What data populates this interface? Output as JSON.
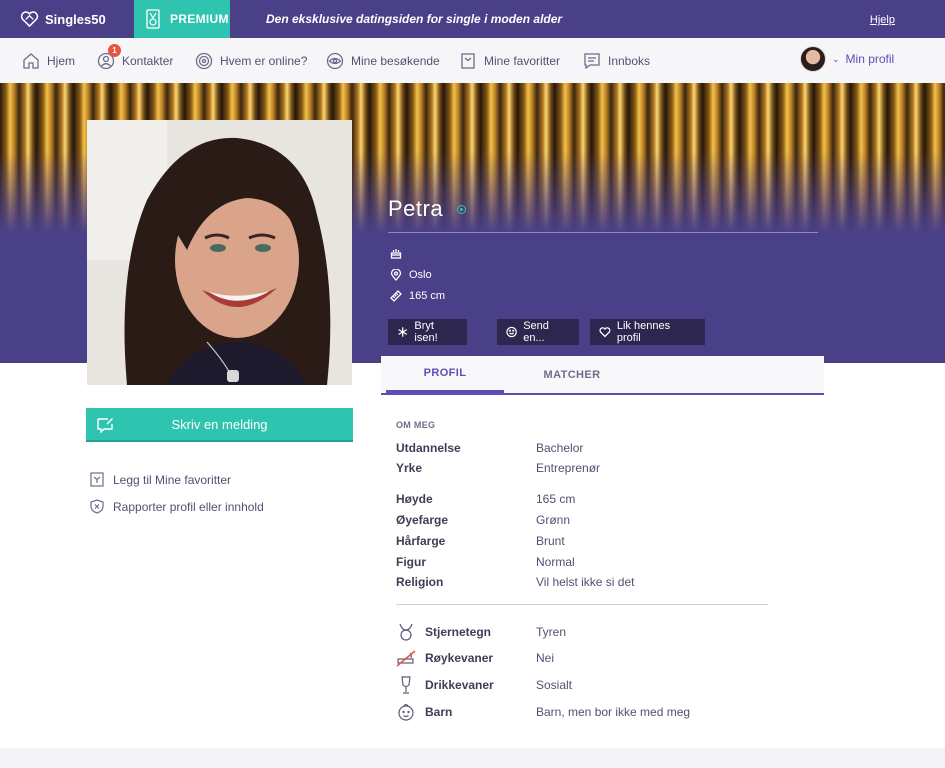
{
  "topbar": {
    "brand": "Singles50",
    "premium": "PREMIUM",
    "tagline": "Den eksklusive datingsiden for single i moden alder",
    "help": "Hjelp"
  },
  "nav": {
    "items": [
      {
        "label": "Hjem",
        "icon": "home-icon"
      },
      {
        "label": "Kontakter",
        "icon": "contacts-icon",
        "badge": "1"
      },
      {
        "label": "Hvem er online?",
        "icon": "online-icon"
      },
      {
        "label": "Mine besøkende",
        "icon": "eye-icon"
      },
      {
        "label": "Mine favoritter",
        "icon": "bookmark-icon"
      },
      {
        "label": "Innboks",
        "icon": "inbox-icon"
      }
    ],
    "my_profile": "Min profil"
  },
  "profile": {
    "name": "Petra",
    "city": "Oslo",
    "height": "165 cm",
    "actions": {
      "icebreaker": "Bryt isen!",
      "send": "Send en...",
      "like": "Lik hennes profil"
    },
    "message_button": "Skriv en melding",
    "add_favorite": "Legg til Mine favoritter",
    "report": "Rapporter profil eller innhold"
  },
  "tabs": {
    "profile": "PROFIL",
    "matches": "MATCHER"
  },
  "details": {
    "section_title": "OM MEG",
    "rows": [
      {
        "k": "Utdannelse",
        "v": "Bachelor"
      },
      {
        "k": "Yrke",
        "v": "Entreprenør"
      },
      {
        "k": "Høyde",
        "v": "165 cm"
      },
      {
        "k": "Øyefarge",
        "v": "Grønn"
      },
      {
        "k": "Hårfarge",
        "v": "Brunt"
      },
      {
        "k": "Figur",
        "v": "Normal"
      },
      {
        "k": "Religion",
        "v": "Vil helst ikke si det"
      }
    ],
    "icon_rows": [
      {
        "k": "Stjernetegn",
        "v": "Tyren",
        "icon": "taurus-icon"
      },
      {
        "k": "Røykevaner",
        "v": "Nei",
        "icon": "no-smoking-icon"
      },
      {
        "k": "Drikkevaner",
        "v": "Sosialt",
        "icon": "glass-icon"
      },
      {
        "k": "Barn",
        "v": "Barn, men bor ikke med meg",
        "icon": "baby-icon"
      }
    ]
  },
  "colors": {
    "purple": "#4a4088",
    "teal": "#2ec4b0",
    "accent": "#5a4fb6"
  }
}
